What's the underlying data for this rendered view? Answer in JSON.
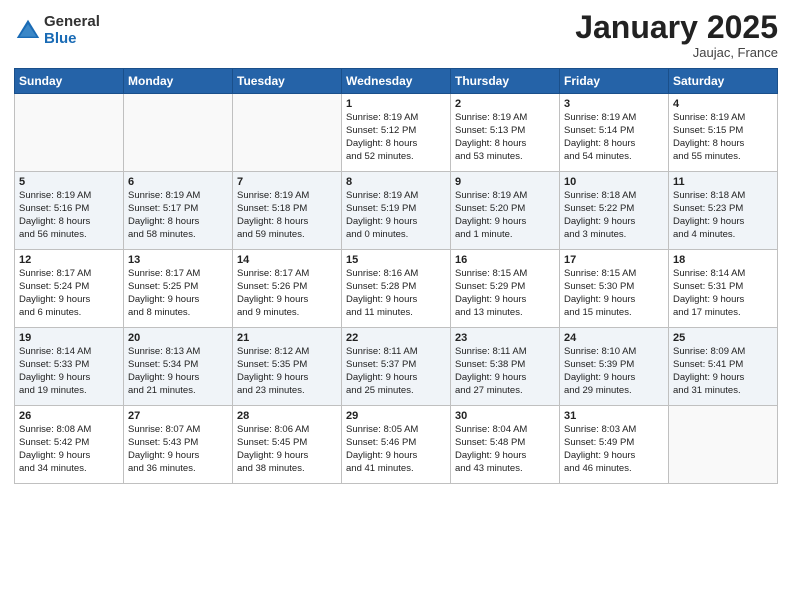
{
  "logo": {
    "general": "General",
    "blue": "Blue"
  },
  "header": {
    "month": "January 2025",
    "location": "Jaujac, France"
  },
  "weekdays": [
    "Sunday",
    "Monday",
    "Tuesday",
    "Wednesday",
    "Thursday",
    "Friday",
    "Saturday"
  ],
  "weeks": [
    [
      {
        "day": "",
        "info": ""
      },
      {
        "day": "",
        "info": ""
      },
      {
        "day": "",
        "info": ""
      },
      {
        "day": "1",
        "info": "Sunrise: 8:19 AM\nSunset: 5:12 PM\nDaylight: 8 hours\nand 52 minutes."
      },
      {
        "day": "2",
        "info": "Sunrise: 8:19 AM\nSunset: 5:13 PM\nDaylight: 8 hours\nand 53 minutes."
      },
      {
        "day": "3",
        "info": "Sunrise: 8:19 AM\nSunset: 5:14 PM\nDaylight: 8 hours\nand 54 minutes."
      },
      {
        "day": "4",
        "info": "Sunrise: 8:19 AM\nSunset: 5:15 PM\nDaylight: 8 hours\nand 55 minutes."
      }
    ],
    [
      {
        "day": "5",
        "info": "Sunrise: 8:19 AM\nSunset: 5:16 PM\nDaylight: 8 hours\nand 56 minutes."
      },
      {
        "day": "6",
        "info": "Sunrise: 8:19 AM\nSunset: 5:17 PM\nDaylight: 8 hours\nand 58 minutes."
      },
      {
        "day": "7",
        "info": "Sunrise: 8:19 AM\nSunset: 5:18 PM\nDaylight: 8 hours\nand 59 minutes."
      },
      {
        "day": "8",
        "info": "Sunrise: 8:19 AM\nSunset: 5:19 PM\nDaylight: 9 hours\nand 0 minutes."
      },
      {
        "day": "9",
        "info": "Sunrise: 8:19 AM\nSunset: 5:20 PM\nDaylight: 9 hours\nand 1 minute."
      },
      {
        "day": "10",
        "info": "Sunrise: 8:18 AM\nSunset: 5:22 PM\nDaylight: 9 hours\nand 3 minutes."
      },
      {
        "day": "11",
        "info": "Sunrise: 8:18 AM\nSunset: 5:23 PM\nDaylight: 9 hours\nand 4 minutes."
      }
    ],
    [
      {
        "day": "12",
        "info": "Sunrise: 8:17 AM\nSunset: 5:24 PM\nDaylight: 9 hours\nand 6 minutes."
      },
      {
        "day": "13",
        "info": "Sunrise: 8:17 AM\nSunset: 5:25 PM\nDaylight: 9 hours\nand 8 minutes."
      },
      {
        "day": "14",
        "info": "Sunrise: 8:17 AM\nSunset: 5:26 PM\nDaylight: 9 hours\nand 9 minutes."
      },
      {
        "day": "15",
        "info": "Sunrise: 8:16 AM\nSunset: 5:28 PM\nDaylight: 9 hours\nand 11 minutes."
      },
      {
        "day": "16",
        "info": "Sunrise: 8:15 AM\nSunset: 5:29 PM\nDaylight: 9 hours\nand 13 minutes."
      },
      {
        "day": "17",
        "info": "Sunrise: 8:15 AM\nSunset: 5:30 PM\nDaylight: 9 hours\nand 15 minutes."
      },
      {
        "day": "18",
        "info": "Sunrise: 8:14 AM\nSunset: 5:31 PM\nDaylight: 9 hours\nand 17 minutes."
      }
    ],
    [
      {
        "day": "19",
        "info": "Sunrise: 8:14 AM\nSunset: 5:33 PM\nDaylight: 9 hours\nand 19 minutes."
      },
      {
        "day": "20",
        "info": "Sunrise: 8:13 AM\nSunset: 5:34 PM\nDaylight: 9 hours\nand 21 minutes."
      },
      {
        "day": "21",
        "info": "Sunrise: 8:12 AM\nSunset: 5:35 PM\nDaylight: 9 hours\nand 23 minutes."
      },
      {
        "day": "22",
        "info": "Sunrise: 8:11 AM\nSunset: 5:37 PM\nDaylight: 9 hours\nand 25 minutes."
      },
      {
        "day": "23",
        "info": "Sunrise: 8:11 AM\nSunset: 5:38 PM\nDaylight: 9 hours\nand 27 minutes."
      },
      {
        "day": "24",
        "info": "Sunrise: 8:10 AM\nSunset: 5:39 PM\nDaylight: 9 hours\nand 29 minutes."
      },
      {
        "day": "25",
        "info": "Sunrise: 8:09 AM\nSunset: 5:41 PM\nDaylight: 9 hours\nand 31 minutes."
      }
    ],
    [
      {
        "day": "26",
        "info": "Sunrise: 8:08 AM\nSunset: 5:42 PM\nDaylight: 9 hours\nand 34 minutes."
      },
      {
        "day": "27",
        "info": "Sunrise: 8:07 AM\nSunset: 5:43 PM\nDaylight: 9 hours\nand 36 minutes."
      },
      {
        "day": "28",
        "info": "Sunrise: 8:06 AM\nSunset: 5:45 PM\nDaylight: 9 hours\nand 38 minutes."
      },
      {
        "day": "29",
        "info": "Sunrise: 8:05 AM\nSunset: 5:46 PM\nDaylight: 9 hours\nand 41 minutes."
      },
      {
        "day": "30",
        "info": "Sunrise: 8:04 AM\nSunset: 5:48 PM\nDaylight: 9 hours\nand 43 minutes."
      },
      {
        "day": "31",
        "info": "Sunrise: 8:03 AM\nSunset: 5:49 PM\nDaylight: 9 hours\nand 46 minutes."
      },
      {
        "day": "",
        "info": ""
      }
    ]
  ]
}
